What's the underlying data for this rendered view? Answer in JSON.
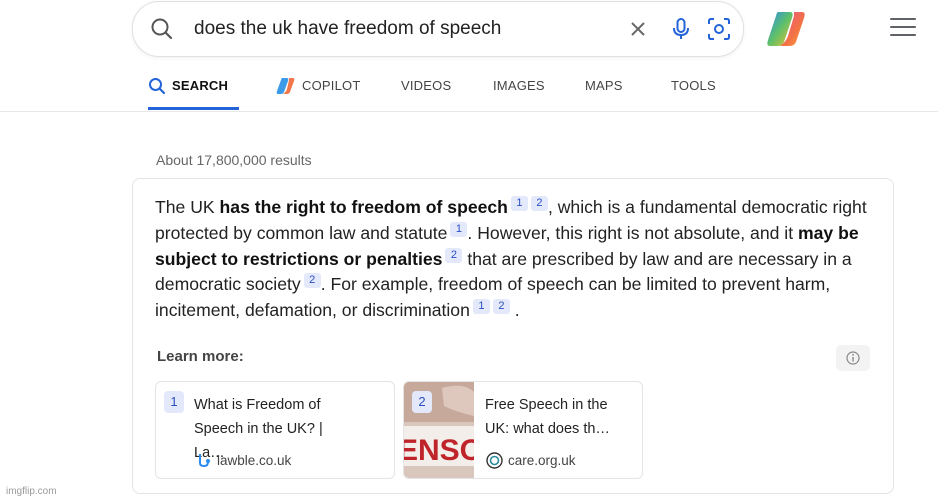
{
  "search": {
    "query": "does the uk have freedom of speech"
  },
  "tabs": [
    {
      "label": "SEARCH"
    },
    {
      "label": "COPILOT"
    },
    {
      "label": "VIDEOS"
    },
    {
      "label": "IMAGES"
    },
    {
      "label": "MAPS"
    },
    {
      "label": "TOOLS"
    }
  ],
  "results_count": "About 17,800,000 results",
  "answer": {
    "p1": "The UK ",
    "b1": "has the right to freedom of speech",
    "p2": ", which is a fundamental democratic right protected by common law and statute",
    "p3": ". However, this right is not absolute, and it ",
    "b2": "may be subject to restrictions or penalties",
    "p4": " that are prescribed by law and are necessary in a democratic society",
    "p5": ". For example, freedom of speech can be limited to prevent harm, incitement, defamation, or discrimination",
    "p6": " .",
    "c1": "1",
    "c2": "2"
  },
  "learn_more": {
    "heading": "Learn more:",
    "sources": [
      {
        "num": "1",
        "title": "What is Freedom of Speech in the UK? | La…",
        "domain": "lawble.co.uk"
      },
      {
        "num": "2",
        "title": "Free Speech in the UK: what does th…",
        "domain": "care.org.uk",
        "thumb_text": "ENSOR"
      }
    ]
  },
  "colors": {
    "accent": "#2463d8",
    "cite_bg": "#e3e9fb",
    "cite_text": "#2a4fc0"
  },
  "watermark": "imgflip.com"
}
